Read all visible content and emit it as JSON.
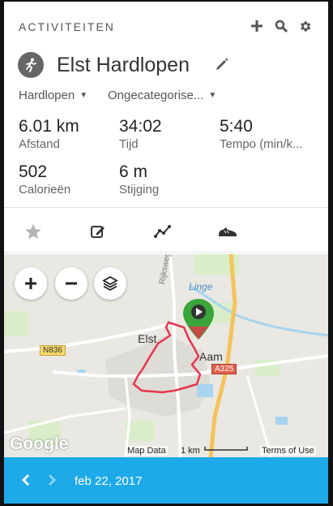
{
  "header": {
    "title": "ACTIVITEITEN",
    "add_icon": "plus-icon",
    "search_icon": "search-icon",
    "settings_icon": "gear-icon"
  },
  "activity": {
    "title": "Elst Hardlopen",
    "type_icon": "running-person-icon",
    "type": "Hardlopen",
    "category": "Ongecategorise..."
  },
  "stats": {
    "distance_value": "6.01 km",
    "distance_label": "Afstand",
    "time_value": "34:02",
    "time_label": "Tijd",
    "pace_value": "5:40",
    "pace_label": "Tempo (min/k...",
    "calories_value": "502",
    "calories_label": "Calorieën",
    "elevation_value": "6 m",
    "elevation_label": "Stijging"
  },
  "tabs": [
    "star-icon",
    "edit-note-icon",
    "route-chart-icon",
    "shoe-icon"
  ],
  "map": {
    "labels": {
      "elst": "Elst",
      "aam": "Aam",
      "linge": "Linge",
      "rijksweg": "Rijksweg Noo",
      "n836": "N836",
      "a325": "A325"
    },
    "google": "Google",
    "map_data": "Map Data",
    "scale": "1 km",
    "terms": "Terms of Use",
    "route_color": "#e8344e",
    "marker_color": "#3aa53a"
  },
  "footer": {
    "date": "feb 22, 2017"
  },
  "colors": {
    "accent": "#1ea9e8"
  }
}
